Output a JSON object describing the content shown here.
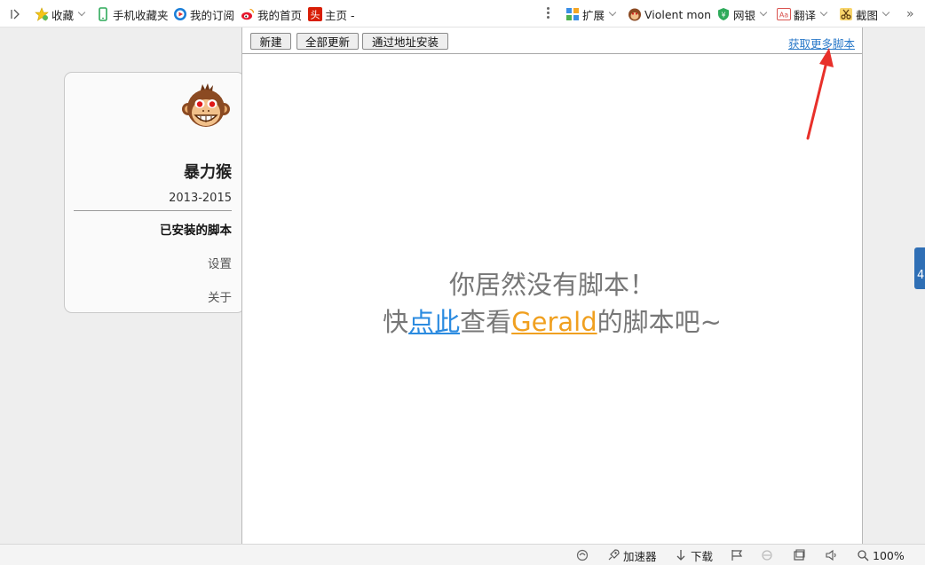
{
  "topbar": {
    "favorites_label": "收藏",
    "mobile_favorites_label": "手机收藏夹",
    "subscriptions_label": "我的订阅",
    "weibo_home_label": "我的首页",
    "toutiao_label": "主页 -",
    "extensions_label": "扩展",
    "violentmonkey_label": "Violent mon",
    "bank_label": "网银",
    "translate_label": "翻译",
    "screenshot_label": "截图",
    "more_symbol": "»"
  },
  "card": {
    "title": "暴力猴",
    "years": "2013-2015",
    "menu": [
      {
        "label": "已安装的脚本",
        "active": true
      },
      {
        "label": "设置",
        "active": false
      },
      {
        "label": "关于",
        "active": false
      }
    ]
  },
  "toolbar": {
    "new_label": "新建",
    "update_all_label": "全部更新",
    "install_url_label": "通过地址安装",
    "more_scripts_link": "获取更多脚本"
  },
  "empty": {
    "line1": "你居然没有脚本！",
    "prefix": "快",
    "click_here": "点此",
    "middle": "查看",
    "gerald": "Gerald",
    "suffix": "的脚本吧~"
  },
  "side_tab": {
    "text": "4"
  },
  "statusbar": {
    "accelerator_label": "加速器",
    "download_label": "下载",
    "zoom_label": "100%"
  },
  "colors": {
    "link_blue": "#2b8be0",
    "gerald_orange": "#f0a020",
    "arrow_red": "#e8302a",
    "side_tab_blue": "#2f6fb5"
  }
}
